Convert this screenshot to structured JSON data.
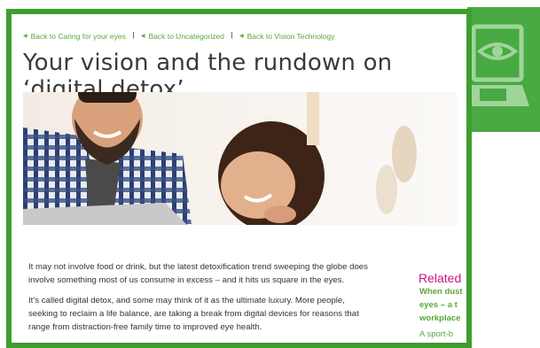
{
  "breadcrumbs": [
    {
      "label": "Back to Caring for your eyes"
    },
    {
      "label": "Back to Uncategorized"
    },
    {
      "label": "Back to Vision Technology"
    }
  ],
  "separator": "|",
  "page_title": "Your vision and the rundown on ‘digital detox’",
  "paragraphs": [
    "It may not involve food or drink, but the latest detoxification trend sweeping the globe does involve something most of us consume in excess – and it hits us square in the eyes.",
    "It’s called digital detox, and some may think of it as the ultimate luxury. More people, seeking to reclaim a life balance, are taking a break from digital devices for reasons that range from distraction-free family time to improved eye health."
  ],
  "sidebar": {
    "heading": "Related",
    "link_lines": [
      "When dust",
      "eyes – a t",
      "workplace"
    ],
    "more": "A sport-b"
  },
  "colors": {
    "frame_green": "#3f9e2f",
    "tile_green": "#49a942",
    "link_green": "#5aa83b",
    "heading_magenta": "#c7177f"
  },
  "icons": {
    "tile": "eye-laptop-icon"
  }
}
